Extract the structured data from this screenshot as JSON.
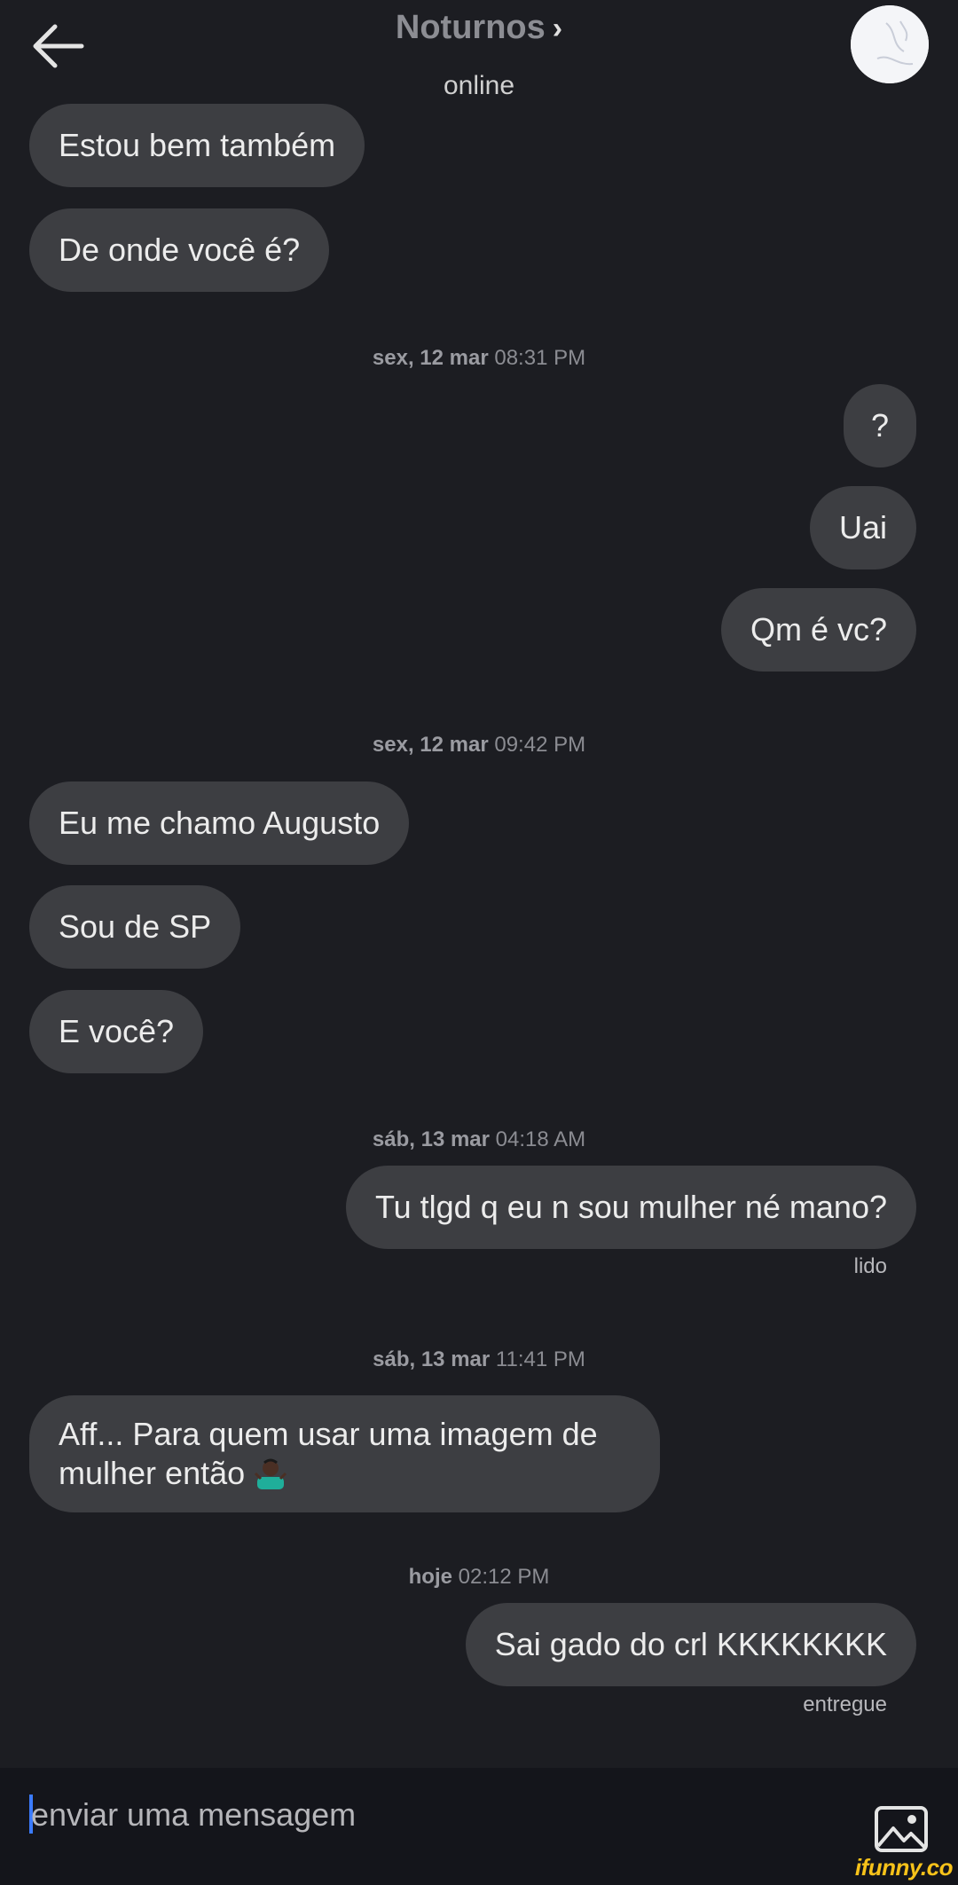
{
  "header": {
    "title": "Noturnos",
    "status": "online"
  },
  "messages": [
    {
      "side": "left",
      "text": "Estou bem também"
    },
    {
      "side": "left",
      "text": "De onde você é?"
    },
    {
      "side": "right",
      "text": "?"
    },
    {
      "side": "right",
      "text": "Uai"
    },
    {
      "side": "right",
      "text": "Qm é vc?"
    },
    {
      "side": "left",
      "text": "Eu me chamo Augusto"
    },
    {
      "side": "left",
      "text": "Sou de SP"
    },
    {
      "side": "left",
      "text": "E você?"
    },
    {
      "side": "right",
      "text": "Tu tlgd q eu n sou mulher né mano?"
    },
    {
      "side": "left",
      "text": "Aff... Para quem usar uma imagem de mulher então"
    },
    {
      "side": "right",
      "text": "Sai gado do crl KKKKKKKK"
    }
  ],
  "timestamps": [
    {
      "day": "sex, 12 mar",
      "time": "08:31 PM"
    },
    {
      "day": "sex, 12 mar",
      "time": "09:42 PM"
    },
    {
      "day": "sáb, 13 mar",
      "time": "04:18 AM"
    },
    {
      "day": "sáb, 13 mar",
      "time": "11:41 PM"
    },
    {
      "day": "hoje",
      "time": "02:12 PM"
    }
  ],
  "receipts": [
    "lido",
    "entregue"
  ],
  "composer": {
    "placeholder": "enviar uma mensagem"
  },
  "icons": {
    "back": "arrow-left-icon",
    "chevron": "chevron-right-icon",
    "attach": "image-icon",
    "emoji": "person-shrugging-emoji"
  },
  "watermark": "ifunny.co",
  "colors": {
    "background": "#1c1d22",
    "bubble": "#3d3e42",
    "composer": "#14151b",
    "caret": "#3b7bff"
  }
}
